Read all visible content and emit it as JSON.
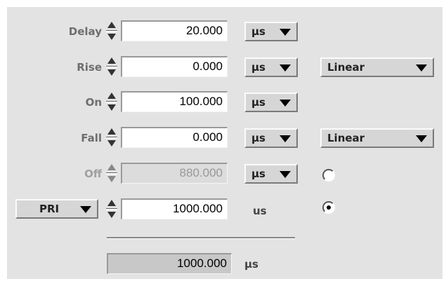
{
  "rows": [
    {
      "label": "Delay",
      "value": "20.000",
      "unit": "µs"
    },
    {
      "label": "Rise",
      "value": "0.000",
      "unit": "µs",
      "shape": "Linear"
    },
    {
      "label": "On",
      "value": "100.000",
      "unit": "µs"
    },
    {
      "label": "Fall",
      "value": "0.000",
      "unit": "µs",
      "shape": "Linear"
    },
    {
      "label": "Off",
      "value": "880.000",
      "unit": "µs",
      "radio_selected": false
    },
    {
      "label": "PRI",
      "value": "1000.000",
      "unit": "us",
      "radio_selected": true
    }
  ],
  "total": {
    "value": "1000.000",
    "unit": "µs"
  },
  "icons": {
    "spinner": "up-down-spinner-icon",
    "dropdown_arrow": "triangle-down-icon",
    "radio": "radio-icon"
  }
}
